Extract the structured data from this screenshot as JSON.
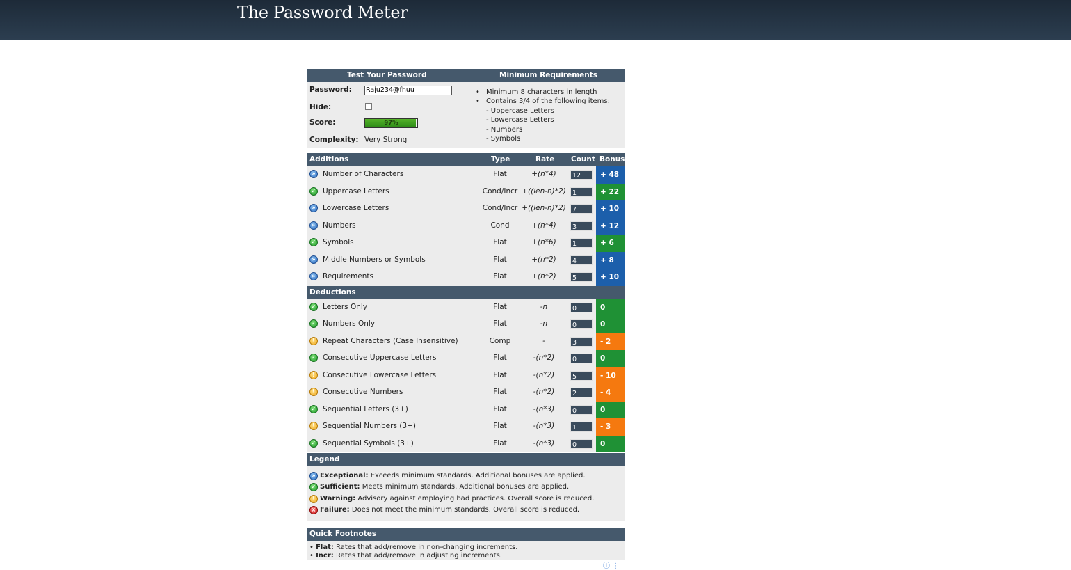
{
  "site": {
    "title": "The Password Meter"
  },
  "test": {
    "header_left": "Test Your Password",
    "header_right": "Minimum Requirements",
    "password_label": "Password:",
    "password_value": "Raju234@fhuu",
    "hide_label": "Hide:",
    "score_label": "Score:",
    "score_text": "97%",
    "score_fraction": 0.97,
    "complexity_label": "Complexity:",
    "complexity_value": "Very Strong"
  },
  "requirements": [
    {
      "text": "Minimum 8 characters in length",
      "bullet": true
    },
    {
      "text": "Contains 3/4 of the following items:",
      "bullet": true
    },
    {
      "text": "- Uppercase Letters",
      "bullet": false
    },
    {
      "text": "- Lowercase Letters",
      "bullet": false
    },
    {
      "text": "- Numbers",
      "bullet": false
    },
    {
      "text": "- Symbols",
      "bullet": false
    }
  ],
  "columns": {
    "additions": "Additions",
    "type": "Type",
    "rate": "Rate",
    "count": "Count",
    "bonus": "Bonus",
    "deductions": "Deductions"
  },
  "additions": [
    {
      "name": "Number of Characters",
      "type": "Flat",
      "rate": "+(n*4)",
      "count": "12",
      "bonus": "+ 48",
      "status": "exc",
      "color": "#1c5fab"
    },
    {
      "name": "Uppercase Letters",
      "type": "Cond/Incr",
      "rate": "+((len-n)*2)",
      "count": "1",
      "bonus": "+ 22",
      "status": "suf",
      "color": "#1f9135"
    },
    {
      "name": "Lowercase Letters",
      "type": "Cond/Incr",
      "rate": "+((len-n)*2)",
      "count": "7",
      "bonus": "+ 10",
      "status": "exc",
      "color": "#1c5fab"
    },
    {
      "name": "Numbers",
      "type": "Cond",
      "rate": "+(n*4)",
      "count": "3",
      "bonus": "+ 12",
      "status": "exc",
      "color": "#1c5fab"
    },
    {
      "name": "Symbols",
      "type": "Flat",
      "rate": "+(n*6)",
      "count": "1",
      "bonus": "+ 6",
      "status": "suf",
      "color": "#1f9135"
    },
    {
      "name": "Middle Numbers or Symbols",
      "type": "Flat",
      "rate": "+(n*2)",
      "count": "4",
      "bonus": "+ 8",
      "status": "exc",
      "color": "#1c5fab"
    },
    {
      "name": "Requirements",
      "type": "Flat",
      "rate": "+(n*2)",
      "count": "5",
      "bonus": "+ 10",
      "status": "exc",
      "color": "#1c5fab"
    }
  ],
  "deductions": [
    {
      "name": "Letters Only",
      "type": "Flat",
      "rate": "-n",
      "count": "0",
      "bonus": "0",
      "status": "suf",
      "color": "#1f9135"
    },
    {
      "name": "Numbers Only",
      "type": "Flat",
      "rate": "-n",
      "count": "0",
      "bonus": "0",
      "status": "suf",
      "color": "#1f9135"
    },
    {
      "name": "Repeat Characters (Case Insensitive)",
      "type": "Comp",
      "rate": "-",
      "count": "3",
      "bonus": "- 2",
      "status": "war",
      "color": "#f5790f"
    },
    {
      "name": "Consecutive Uppercase Letters",
      "type": "Flat",
      "rate": "-(n*2)",
      "count": "0",
      "bonus": "0",
      "status": "suf",
      "color": "#1f9135"
    },
    {
      "name": "Consecutive Lowercase Letters",
      "type": "Flat",
      "rate": "-(n*2)",
      "count": "5",
      "bonus": "- 10",
      "status": "war",
      "color": "#f5790f"
    },
    {
      "name": "Consecutive Numbers",
      "type": "Flat",
      "rate": "-(n*2)",
      "count": "2",
      "bonus": "- 4",
      "status": "war",
      "color": "#f5790f"
    },
    {
      "name": "Sequential Letters (3+)",
      "type": "Flat",
      "rate": "-(n*3)",
      "count": "0",
      "bonus": "0",
      "status": "suf",
      "color": "#1f9135"
    },
    {
      "name": "Sequential Numbers (3+)",
      "type": "Flat",
      "rate": "-(n*3)",
      "count": "1",
      "bonus": "- 3",
      "status": "war",
      "color": "#f5790f"
    },
    {
      "name": "Sequential Symbols (3+)",
      "type": "Flat",
      "rate": "-(n*3)",
      "count": "0",
      "bonus": "0",
      "status": "suf",
      "color": "#1f9135"
    }
  ],
  "legend": {
    "title": "Legend",
    "items": [
      {
        "status": "exc",
        "term": "Exceptional:",
        "desc": " Exceeds minimum standards. Additional bonuses are applied."
      },
      {
        "status": "suf",
        "term": "Sufficient:",
        "desc": " Meets minimum standards. Additional bonuses are applied."
      },
      {
        "status": "war",
        "term": "Warning:",
        "desc": " Advisory against employing bad practices. Overall score is reduced."
      },
      {
        "status": "fai",
        "term": "Failure:",
        "desc": " Does not meet the minimum standards. Overall score is reduced."
      }
    ]
  },
  "footnotes": {
    "title": "Quick Footnotes",
    "items": [
      {
        "term": "Flat:",
        "desc": " Rates that add/remove in non-changing increments."
      },
      {
        "term": "Incr:",
        "desc": " Rates that add/remove in adjusting increments."
      }
    ]
  }
}
